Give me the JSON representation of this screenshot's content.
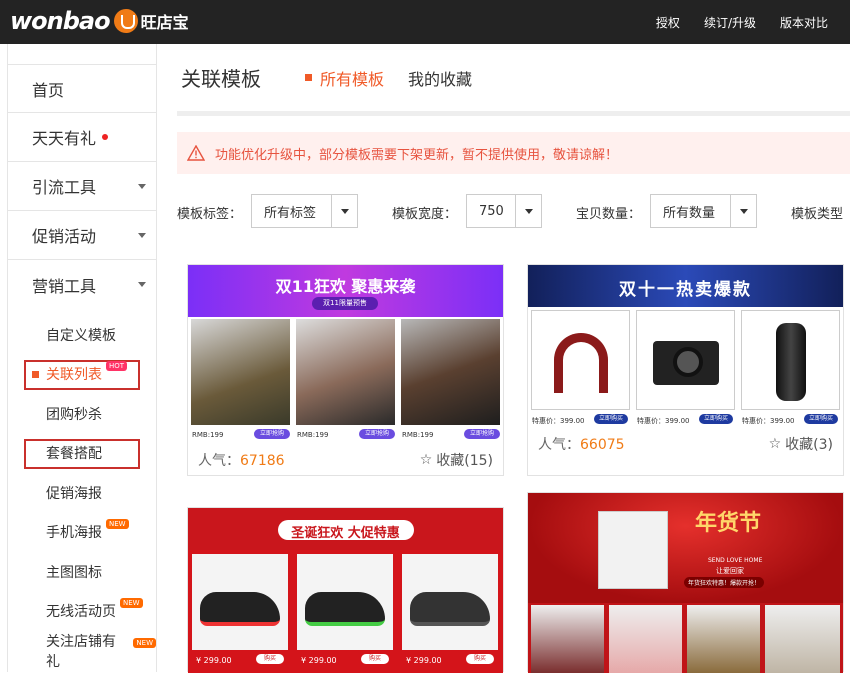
{
  "header": {
    "logo_text": "wonbao",
    "logo_cn": "旺店宝",
    "nav": [
      "授权",
      "续订/升级",
      "版本对比"
    ]
  },
  "sidebar": {
    "items": [
      {
        "label": "首页"
      },
      {
        "label": "天天有礼"
      },
      {
        "label": "引流工具"
      },
      {
        "label": "促销活动"
      },
      {
        "label": "营销工具"
      }
    ],
    "sub_items": [
      {
        "label": "自定义模板"
      },
      {
        "label": "关联列表",
        "tag": "HOT"
      },
      {
        "label": "团购秒杀"
      },
      {
        "label": "套餐搭配"
      },
      {
        "label": "促销海报"
      },
      {
        "label": "手机海报",
        "tag": "NEW"
      },
      {
        "label": "主图图标"
      },
      {
        "label": "无线活动页",
        "tag": "NEW"
      },
      {
        "label": "关注店铺有礼",
        "tag": "NEW"
      }
    ]
  },
  "main": {
    "title": "关联模板",
    "tab_all": "所有模板",
    "tab_fav": "我的收藏",
    "notice": "功能优化升级中，部分模板需要下架更新，暂不提供使用，敬请谅解！",
    "filters": {
      "tag_label": "模板标签：",
      "tag_value": "所有标签",
      "width_label": "模板宽度：",
      "width_value": "750",
      "count_label": "宝贝数量：",
      "count_value": "所有数量",
      "type_label": "模板类型"
    }
  },
  "cards": [
    {
      "banner_title": "双11狂欢  聚惠来袭",
      "banner_sub": "双11限量预售",
      "prices": [
        "RMB:199",
        "RMB:199",
        "RMB:199"
      ],
      "buy_label": "立即抢购",
      "pop_label": "人气：",
      "pop_value": "67186",
      "fav_label": "收藏(15)"
    },
    {
      "banner_title": "双十一热卖爆款",
      "prices": [
        "特惠价：399.00",
        "特惠价：399.00",
        "特惠价：399.00"
      ],
      "buy_label": "立即购买",
      "pop_label": "人气：",
      "pop_value": "66075",
      "fav_label": "收藏(3)"
    },
    {
      "banner_title": "圣诞狂欢 大促特惠",
      "prices": [
        "¥ 299.00",
        "¥ 299.00",
        "¥ 299.00"
      ],
      "buy_label": "购买"
    },
    {
      "banner_title": "年货节",
      "banner_sub1": "SEND LOVE HOME",
      "banner_sub2": "让爱回家",
      "banner_sub3": "年货狂欢特惠！爆款开抢！"
    }
  ]
}
